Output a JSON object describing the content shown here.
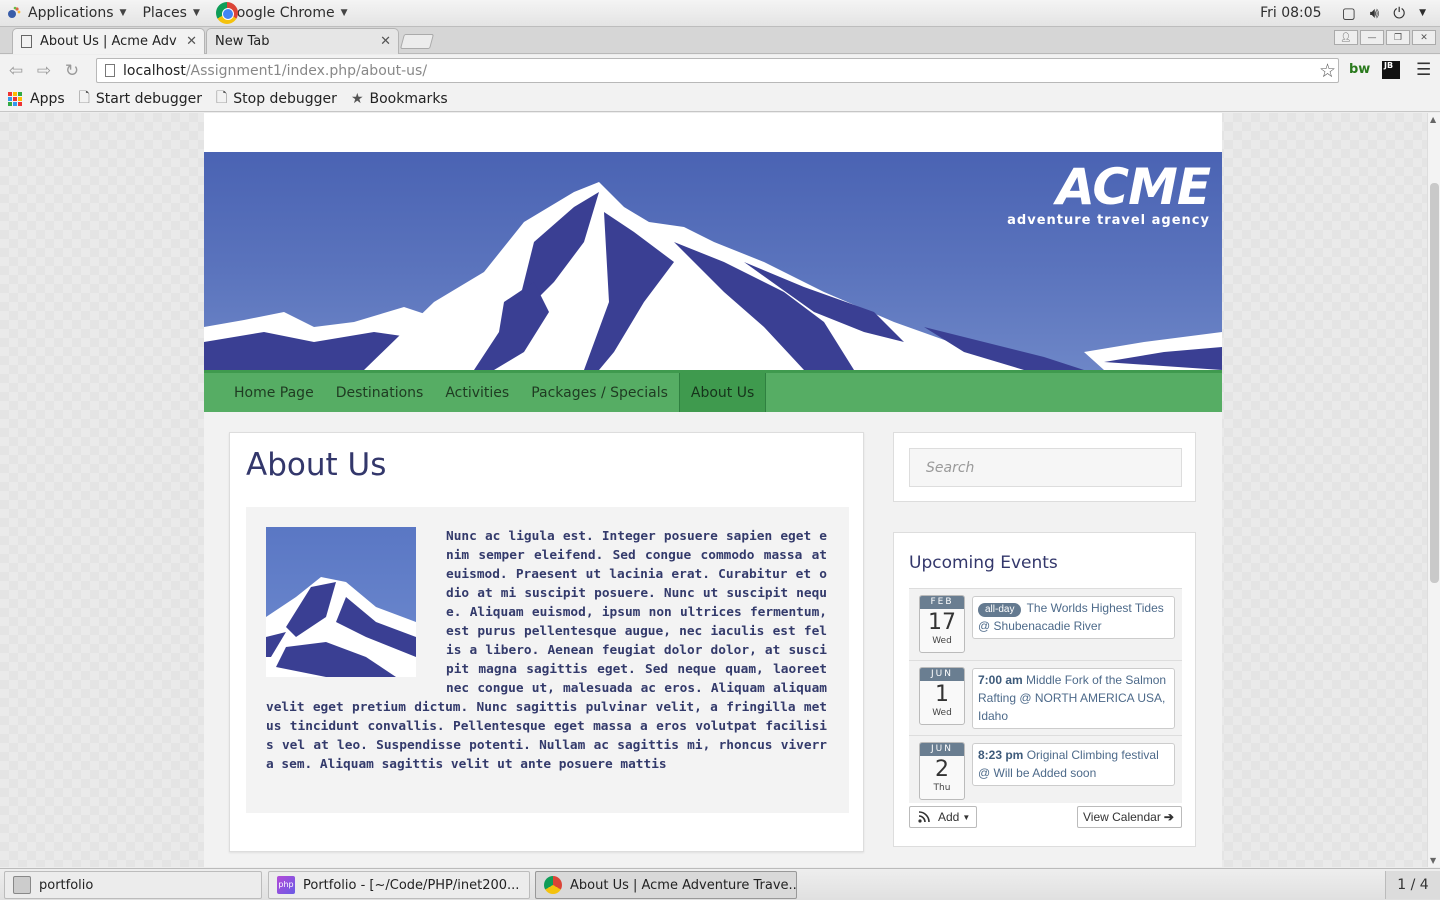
{
  "top_panel": {
    "applications": "Applications",
    "places": "Places",
    "active_app": "Google Chrome",
    "clock": "Fri 08:05"
  },
  "browser": {
    "tabs": [
      {
        "title": "About Us | Acme Adv",
        "active": true
      },
      {
        "title": "New Tab",
        "active": false
      }
    ],
    "url_host": "localhost",
    "url_path": "/Assignment1/index.php/about-us/",
    "extensions": {
      "bw": "bw",
      "jb": "JB"
    },
    "bookmarks": [
      {
        "label": "Apps",
        "icon": "apps-grid-icon"
      },
      {
        "label": "Start debugger",
        "icon": "page-icon"
      },
      {
        "label": "Stop debugger",
        "icon": "page-icon"
      },
      {
        "label": "Bookmarks",
        "icon": "star-icon"
      }
    ]
  },
  "site": {
    "logo_word": "ACME",
    "logo_tagline": "adventure travel agency",
    "nav": [
      "Home Page",
      "Destinations",
      "Activities",
      "Packages / Specials",
      "About Us"
    ],
    "active_nav": "About Us",
    "page_title": "About Us",
    "body_text": "Nunc ac ligula est. Integer posuere sapien eget enim semper eleifend. Sed congue commodo massa at euismod. Praesent ut lacinia erat. Curabitur et odio at mi suscipit posuere. Nunc ut suscipit neque. Aliquam euismod, ipsum non ultrices fermentum, est purus pellentesque augue, nec iaculis est felis a libero. Aenean feugiat dolor dolor, at suscipit magna sagittis eget. Sed neque quam, laoreet nec congue ut, malesuada ac eros. Aliquam aliquam velit eget pretium dictum. Nunc sagittis pulvinar velit, a fringilla metus tincidunt convallis. Pellentesque eget massa a eros volutpat facilisis vel at leo. Suspendisse potenti. Nullam ac sagittis mi, rhoncus viverra sem. Aliquam sagittis velit ut ante posuere mattis",
    "search_placeholder": "Search",
    "events_title": "Upcoming Events",
    "events": [
      {
        "month": "FEB",
        "day": "17",
        "weekday": "Wed",
        "badge": "all-day",
        "time": "",
        "title": "The Worlds Highest Tides @ Shubenacadie River"
      },
      {
        "month": "JUN",
        "day": "1",
        "weekday": "Wed",
        "badge": "",
        "time": "7:00 am",
        "title": "Middle Fork of the Salmon Rafting @ NORTH AMERICA USA, Idaho"
      },
      {
        "month": "JUN",
        "day": "2",
        "weekday": "Thu",
        "badge": "",
        "time": "8:23 pm",
        "title": "Original Climbing festival @ Will be Added soon"
      }
    ],
    "add_label": "Add",
    "view_calendar_label": "View Calendar"
  },
  "taskbar": {
    "tasks": [
      {
        "label": "portfolio",
        "active": false
      },
      {
        "label": "Portfolio - [~/Code/PHP/inet200...",
        "active": false
      },
      {
        "label": "About Us | Acme Adventure Trave...",
        "active": true
      }
    ],
    "workspace": "1 / 4"
  },
  "colors": {
    "nav_green": "#56ad64",
    "banner_blue": "#4a63b3",
    "heading_navy": "#33376b"
  }
}
